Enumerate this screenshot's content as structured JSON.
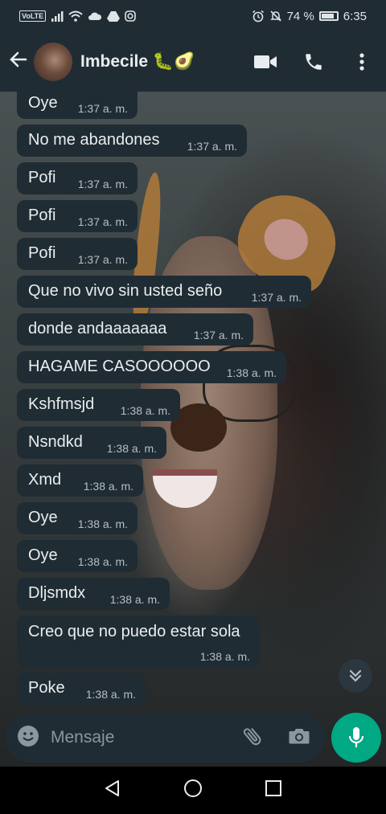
{
  "status_bar": {
    "network_badge": "VoLTE",
    "battery": "74 %",
    "battery_level": 0.74,
    "time": "6:35"
  },
  "header": {
    "contact_name": "Imbecile 🐛🥑",
    "icons": [
      "back-arrow-icon",
      "video-call-icon",
      "phone-call-icon",
      "more-options-icon"
    ]
  },
  "messages": [
    {
      "text": "Oye",
      "time": "1:37 a. m."
    },
    {
      "text": "No me abandones",
      "time": "1:37 a. m."
    },
    {
      "text": "Pofi",
      "time": "1:37 a. m."
    },
    {
      "text": "Pofi",
      "time": "1:37 a. m."
    },
    {
      "text": "Pofi",
      "time": "1:37 a. m."
    },
    {
      "text": "Que no vivo sin usted seño",
      "time": "1:37 a. m."
    },
    {
      "text": "donde andaaaaaaa",
      "time": "1:37 a. m."
    },
    {
      "text": "HAGAME CASOOOOOO",
      "time": "1:38 a. m."
    },
    {
      "text": "Kshfmsjd",
      "time": "1:38 a. m."
    },
    {
      "text": "Nsndkd",
      "time": "1:38 a. m."
    },
    {
      "text": "Xmd",
      "time": "1:38 a. m."
    },
    {
      "text": "Oye",
      "time": "1:38 a. m."
    },
    {
      "text": "Oye",
      "time": "1:38 a. m."
    },
    {
      "text": "Dljsmdx",
      "time": "1:38 a. m."
    },
    {
      "text": "Creo que no puedo estar sola",
      "time": "1:38 a. m."
    },
    {
      "text": "Poke",
      "time": "1:38 a. m."
    }
  ],
  "composer": {
    "placeholder": "Mensaje"
  },
  "colors": {
    "bar": "#1f2c34",
    "bubble": "#1f2c34",
    "accent": "#00a884",
    "text": "#e9edef",
    "muted": "#b6bfc5"
  }
}
